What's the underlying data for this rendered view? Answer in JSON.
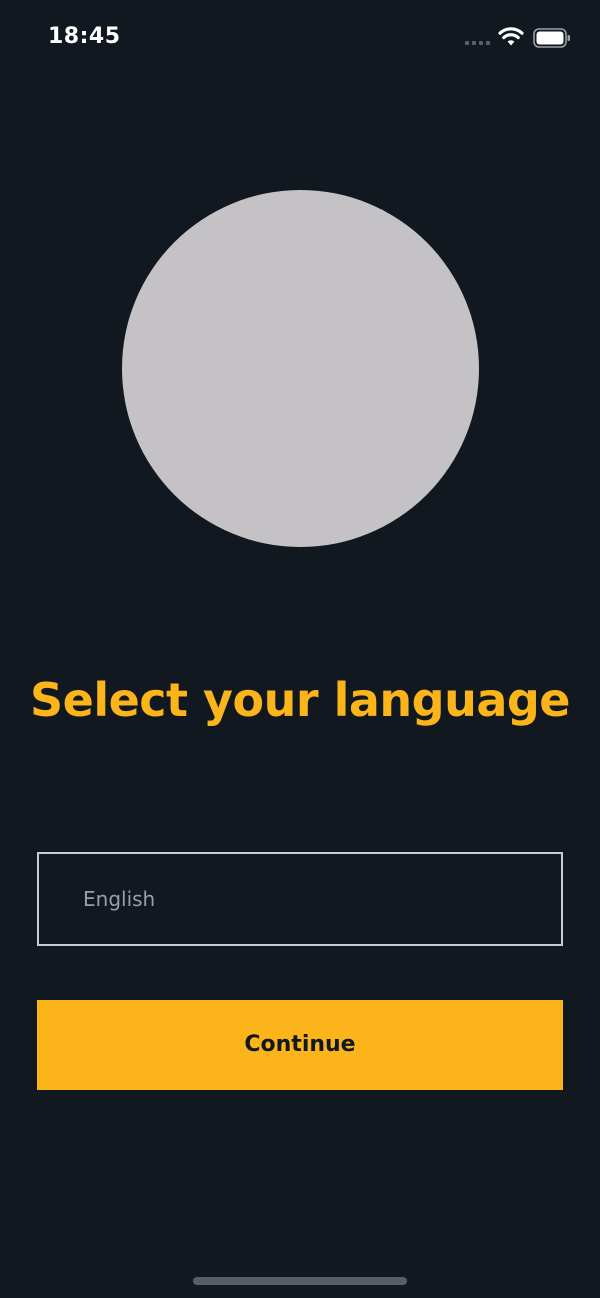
{
  "status_bar": {
    "time": "18:45",
    "icons": [
      "signal-icon",
      "wifi-icon",
      "battery-icon"
    ]
  },
  "main": {
    "illustration": "placeholder-circle",
    "title": "Select your language",
    "language_select": {
      "value": "English"
    },
    "continue_label": "Continue"
  },
  "colors": {
    "background": "#111820",
    "accent": "#fbb51b",
    "placeholder_circle": "#c4c2c4",
    "select_border": "#c9ccd2",
    "select_text": "#9a9ea6"
  }
}
